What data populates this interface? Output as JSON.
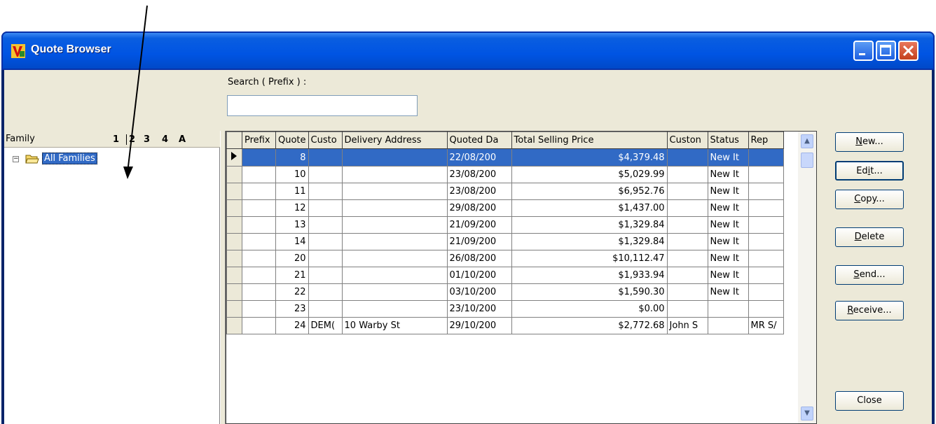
{
  "window": {
    "title": "Quote Browser"
  },
  "search": {
    "label": "Search ( Prefix ) :",
    "value": "",
    "placeholder": ""
  },
  "family": {
    "header": "Family",
    "levels": [
      "1",
      "2",
      "3",
      "4",
      "A"
    ],
    "tree_root": "All Families"
  },
  "grid": {
    "columns": [
      "Prefix",
      "Quote",
      "Custo",
      "Delivery Address",
      "Quoted Da",
      "Total Selling Price",
      "Custon",
      "Status",
      "Rep"
    ],
    "rows": [
      [
        "",
        "8",
        "",
        "",
        "22/08/200",
        "$4,379.48",
        "",
        "New It",
        ""
      ],
      [
        "",
        "10",
        "",
        "",
        "23/08/200",
        "$5,029.99",
        "",
        "New It",
        ""
      ],
      [
        "",
        "11",
        "",
        "",
        "23/08/200",
        "$6,952.76",
        "",
        "New It",
        ""
      ],
      [
        "",
        "12",
        "",
        "",
        "29/08/200",
        "$1,437.00",
        "",
        "New It",
        ""
      ],
      [
        "",
        "13",
        "",
        "",
        "21/09/200",
        "$1,329.84",
        "",
        "New It",
        ""
      ],
      [
        "",
        "14",
        "",
        "",
        "21/09/200",
        "$1,329.84",
        "",
        "New It",
        ""
      ],
      [
        "",
        "20",
        "",
        "",
        "26/08/200",
        "$10,112.47",
        "",
        "New It",
        ""
      ],
      [
        "",
        "21",
        "",
        "",
        "01/10/200",
        "$1,933.94",
        "",
        "New It",
        ""
      ],
      [
        "",
        "22",
        "",
        "",
        "03/10/200",
        "$1,590.30",
        "",
        "New It",
        ""
      ],
      [
        "",
        "23",
        "",
        "",
        "23/10/200",
        "$0.00",
        "",
        "",
        ""
      ],
      [
        "",
        "24",
        "DEM(",
        "10 Warby St",
        "29/10/200",
        "$2,772.68",
        "John S",
        "",
        "MR S/"
      ]
    ],
    "selected_row": 0
  },
  "buttons": {
    "new": {
      "pre": "",
      "key": "N",
      "post": "ew..."
    },
    "edit": {
      "pre": "Ed",
      "key": "i",
      "post": "t..."
    },
    "copy": {
      "pre": "",
      "key": "C",
      "post": "opy..."
    },
    "delete": {
      "pre": "",
      "key": "D",
      "post": "elete"
    },
    "send": {
      "pre": "",
      "key": "S",
      "post": "end..."
    },
    "receive": {
      "pre": "",
      "key": "R",
      "post": "eceive..."
    },
    "close": "Close"
  },
  "colors": {
    "titlebar": "#0054e3",
    "selection": "#316ac5",
    "face": "#ece9d8"
  },
  "icons": [
    "app-icon",
    "minimize-icon",
    "maximize-icon",
    "close-icon",
    "folder-open-icon",
    "row-indicator-icon",
    "scroll-up-icon",
    "scroll-down-icon"
  ]
}
